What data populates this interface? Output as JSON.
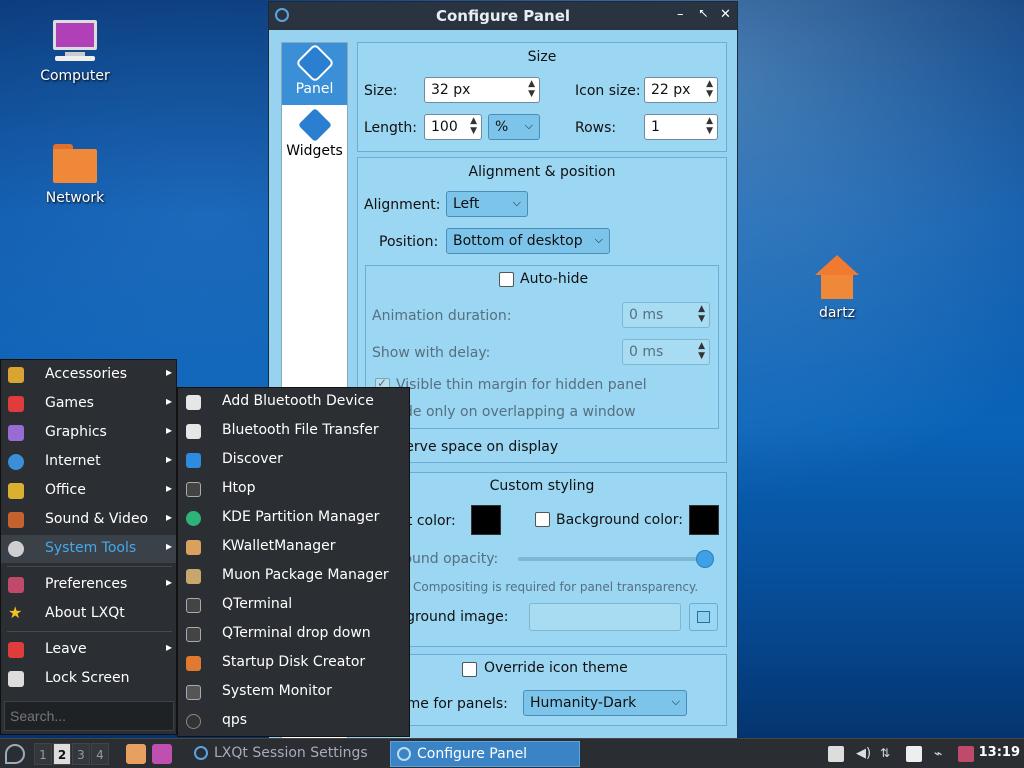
{
  "desktop": {
    "icons": [
      {
        "label": "Computer"
      },
      {
        "label": "Network"
      },
      {
        "label": "dartz"
      }
    ]
  },
  "window": {
    "title": "Configure Panel",
    "controls": [
      "–",
      "⭦",
      "✕"
    ],
    "sidebar": [
      {
        "label": "Panel"
      },
      {
        "label": "Widgets"
      }
    ],
    "size_group": {
      "title": "Size",
      "size_label": "Size:",
      "size_value": "32 px",
      "icon_size_label": "Icon size:",
      "icon_size_value": "22 px",
      "length_label": "Length:",
      "length_value": "100",
      "length_unit": "%",
      "rows_label": "Rows:",
      "rows_value": "1"
    },
    "alignment_group": {
      "title": "Alignment & position",
      "alignment_label": "Alignment:",
      "alignment_value": "Left",
      "position_label": "Position:",
      "position_value": "Bottom of desktop",
      "autohide_label": "Auto-hide",
      "animation_label": "Animation duration:",
      "animation_value": "0 ms",
      "delay_label": "Show with delay:",
      "delay_value": "0 ms",
      "thin_margin_label": "Visible thin margin for hidden panel",
      "overlap_label": "de only on overlapping a window",
      "reserve_label": "serve space on display"
    },
    "styling_group": {
      "title": "Custom styling",
      "font_color_label": "nt color:",
      "bg_color_label": "Background color:",
      "opacity_label": "round opacity:",
      "compositing_note": "Compositing is required for panel transparency.",
      "bg_image_label": "kground image:"
    },
    "icon_theme_group": {
      "override_label": "Override icon theme",
      "theme_label": "eme for panels:",
      "theme_value": "Humanity-Dark"
    }
  },
  "main_menu": {
    "items": [
      {
        "label": "Accessories",
        "icon": "accessories-icon",
        "color": "#d9a431"
      },
      {
        "label": "Games",
        "icon": "games-icon",
        "color": "#e03c3c"
      },
      {
        "label": "Graphics",
        "icon": "graphics-icon",
        "color": "#9b6bd4"
      },
      {
        "label": "Internet",
        "icon": "internet-icon",
        "color": "#3a8fd6"
      },
      {
        "label": "Office",
        "icon": "office-icon",
        "color": "#d9b030"
      },
      {
        "label": "Sound & Video",
        "icon": "sound-video-icon",
        "color": "#c4622d"
      },
      {
        "label": "System Tools",
        "icon": "gear-icon",
        "color": "#cfcfcf"
      },
      {
        "label": "Preferences",
        "icon": "preferences-icon",
        "color": "#c04a6a"
      },
      {
        "label": "About LXQt",
        "icon": "star-icon",
        "color": "#f2c21f"
      },
      {
        "label": "Leave",
        "icon": "power-icon",
        "color": "#e03c3c"
      },
      {
        "label": "Lock Screen",
        "icon": "lock-icon",
        "color": "#dddddd"
      }
    ],
    "search_placeholder": "Search..."
  },
  "submenu": {
    "items": [
      {
        "label": "Add Bluetooth Device",
        "icon": "bluetooth-icon",
        "color": "#e6e6e6"
      },
      {
        "label": "Bluetooth File Transfer",
        "icon": "bluetooth-icon",
        "color": "#e6e6e6"
      },
      {
        "label": "Discover",
        "icon": "discover-icon",
        "color": "#2f8be0"
      },
      {
        "label": "Htop",
        "icon": "terminal-icon",
        "color": "#444444"
      },
      {
        "label": "KDE Partition Manager",
        "icon": "partition-icon",
        "color": "#2db37a"
      },
      {
        "label": "KWalletManager",
        "icon": "wallet-icon",
        "color": "#d9a060"
      },
      {
        "label": "Muon Package Manager",
        "icon": "package-icon",
        "color": "#c9a66b"
      },
      {
        "label": "QTerminal",
        "icon": "terminal-icon",
        "color": "#444444"
      },
      {
        "label": "QTerminal drop down",
        "icon": "terminal-icon",
        "color": "#444444"
      },
      {
        "label": "Startup Disk Creator",
        "icon": "disk-icon",
        "color": "#e07a30"
      },
      {
        "label": "System Monitor",
        "icon": "monitor-icon",
        "color": "#555555"
      },
      {
        "label": "qps",
        "icon": "qps-icon",
        "color": "#333333"
      }
    ]
  },
  "taskbar": {
    "workspaces": [
      "1",
      "2",
      "3",
      "4"
    ],
    "tasks": [
      "LXQt Session Settings",
      "Configure Panel"
    ],
    "clock": "13:19"
  }
}
